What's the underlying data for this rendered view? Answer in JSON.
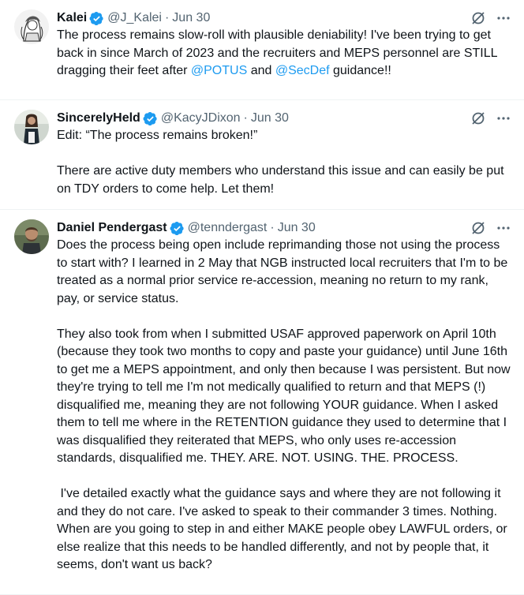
{
  "tweets": [
    {
      "name": "Kalei",
      "handle": "@J_Kalei",
      "separator": "·",
      "time": "Jun 30",
      "text_before": "The process remains slow-roll with plausible deniability! I've been trying to get back in since March of 2023 and the recruiters and MEPS personnel are STILL dragging their feet after ",
      "mention1": "@POTUS",
      "text_mid": " and ",
      "mention2": "@SecDef",
      "text_after": " guidance!!",
      "icons": [
        "verified-icon",
        "grok-icon",
        "more-icon"
      ]
    },
    {
      "name": "SincerelyHeld",
      "handle": "@KacyJDixon",
      "separator": "·",
      "time": "Jun 30",
      "text": "Edit: “The process remains broken!”\n\nThere are active duty members who understand this issue and can easily be put on TDY orders to come help. Let them!",
      "icons": [
        "verified-icon",
        "grok-icon",
        "more-icon"
      ]
    },
    {
      "name": "Daniel Pendergast",
      "handle": "@tenndergast",
      "separator": "·",
      "time": "Jun 30",
      "text": "Does the process being open include reprimanding those not using the process to start with? I learned in 2 May that NGB instructed local recruiters that I'm to be treated as a normal prior service re-accession, meaning no return to my rank, pay, or service status.\n\nThey also took from when I submitted USAF approved paperwork on April 10th (because they took two months to copy and paste your guidance) until June 16th to get me a MEPS appointment, and only then because I was persistent. But now they're trying to tell me I'm not medically qualified to return and that MEPS (!) disqualified me, meaning they are not following YOUR guidance. When I asked them to tell me where in the RETENTION guidance they used to determine that I was disqualified they reiterated that MEPS, who only uses re-accession standards, disqualified me. THEY. ARE. NOT. USING. THE. PROCESS.\n\n I've detailed exactly what the guidance says and where they are not following it and they do not care. I've asked to speak to their commander 3 times. Nothing.  When are you going to step in and either MAKE people obey LAWFUL orders, or else realize that this needs to be handled differently, and not by people that, it seems, don't want us back?",
      "icons": [
        "verified-icon",
        "grok-icon",
        "more-icon"
      ]
    }
  ],
  "colors": {
    "text": "#0f1419",
    "muted": "#536471",
    "link": "#1d9bf0",
    "verified": "#1d9bf0",
    "border": "#eff3f4"
  }
}
